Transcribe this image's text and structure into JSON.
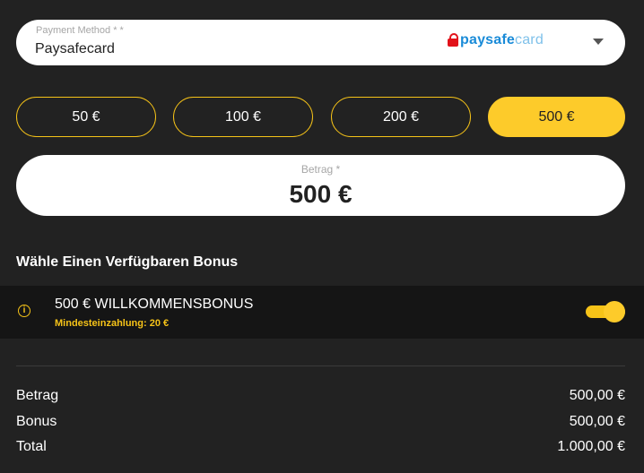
{
  "payment_method": {
    "label": "Payment Method * *",
    "value": "Paysafecard",
    "logo_text_bold": "paysafe",
    "logo_text_light": "card"
  },
  "amount_options": [
    {
      "label": "50 €",
      "selected": false
    },
    {
      "label": "100 €",
      "selected": false
    },
    {
      "label": "200 €",
      "selected": false
    },
    {
      "label": "500 €",
      "selected": true
    }
  ],
  "amount_field": {
    "label": "Betrag *",
    "value": "500 €"
  },
  "bonus": {
    "heading": "Wähle Einen Verfügbaren Bonus",
    "title": "500 € WILLKOMMENSBONUS",
    "subtitle": "Mindesteinzahlung: 20 €",
    "info_glyph": "i",
    "enabled": true
  },
  "summary": [
    {
      "label": "Betrag",
      "value": "500,00 €"
    },
    {
      "label": "Bonus",
      "value": "500,00 €"
    },
    {
      "label": "Total",
      "value": "1.000,00 €"
    }
  ],
  "colors": {
    "background": "#222222",
    "accent": "#fdcb2a",
    "paysafe_blue": "#1a8bd8",
    "paysafe_red": "#e2121a"
  }
}
